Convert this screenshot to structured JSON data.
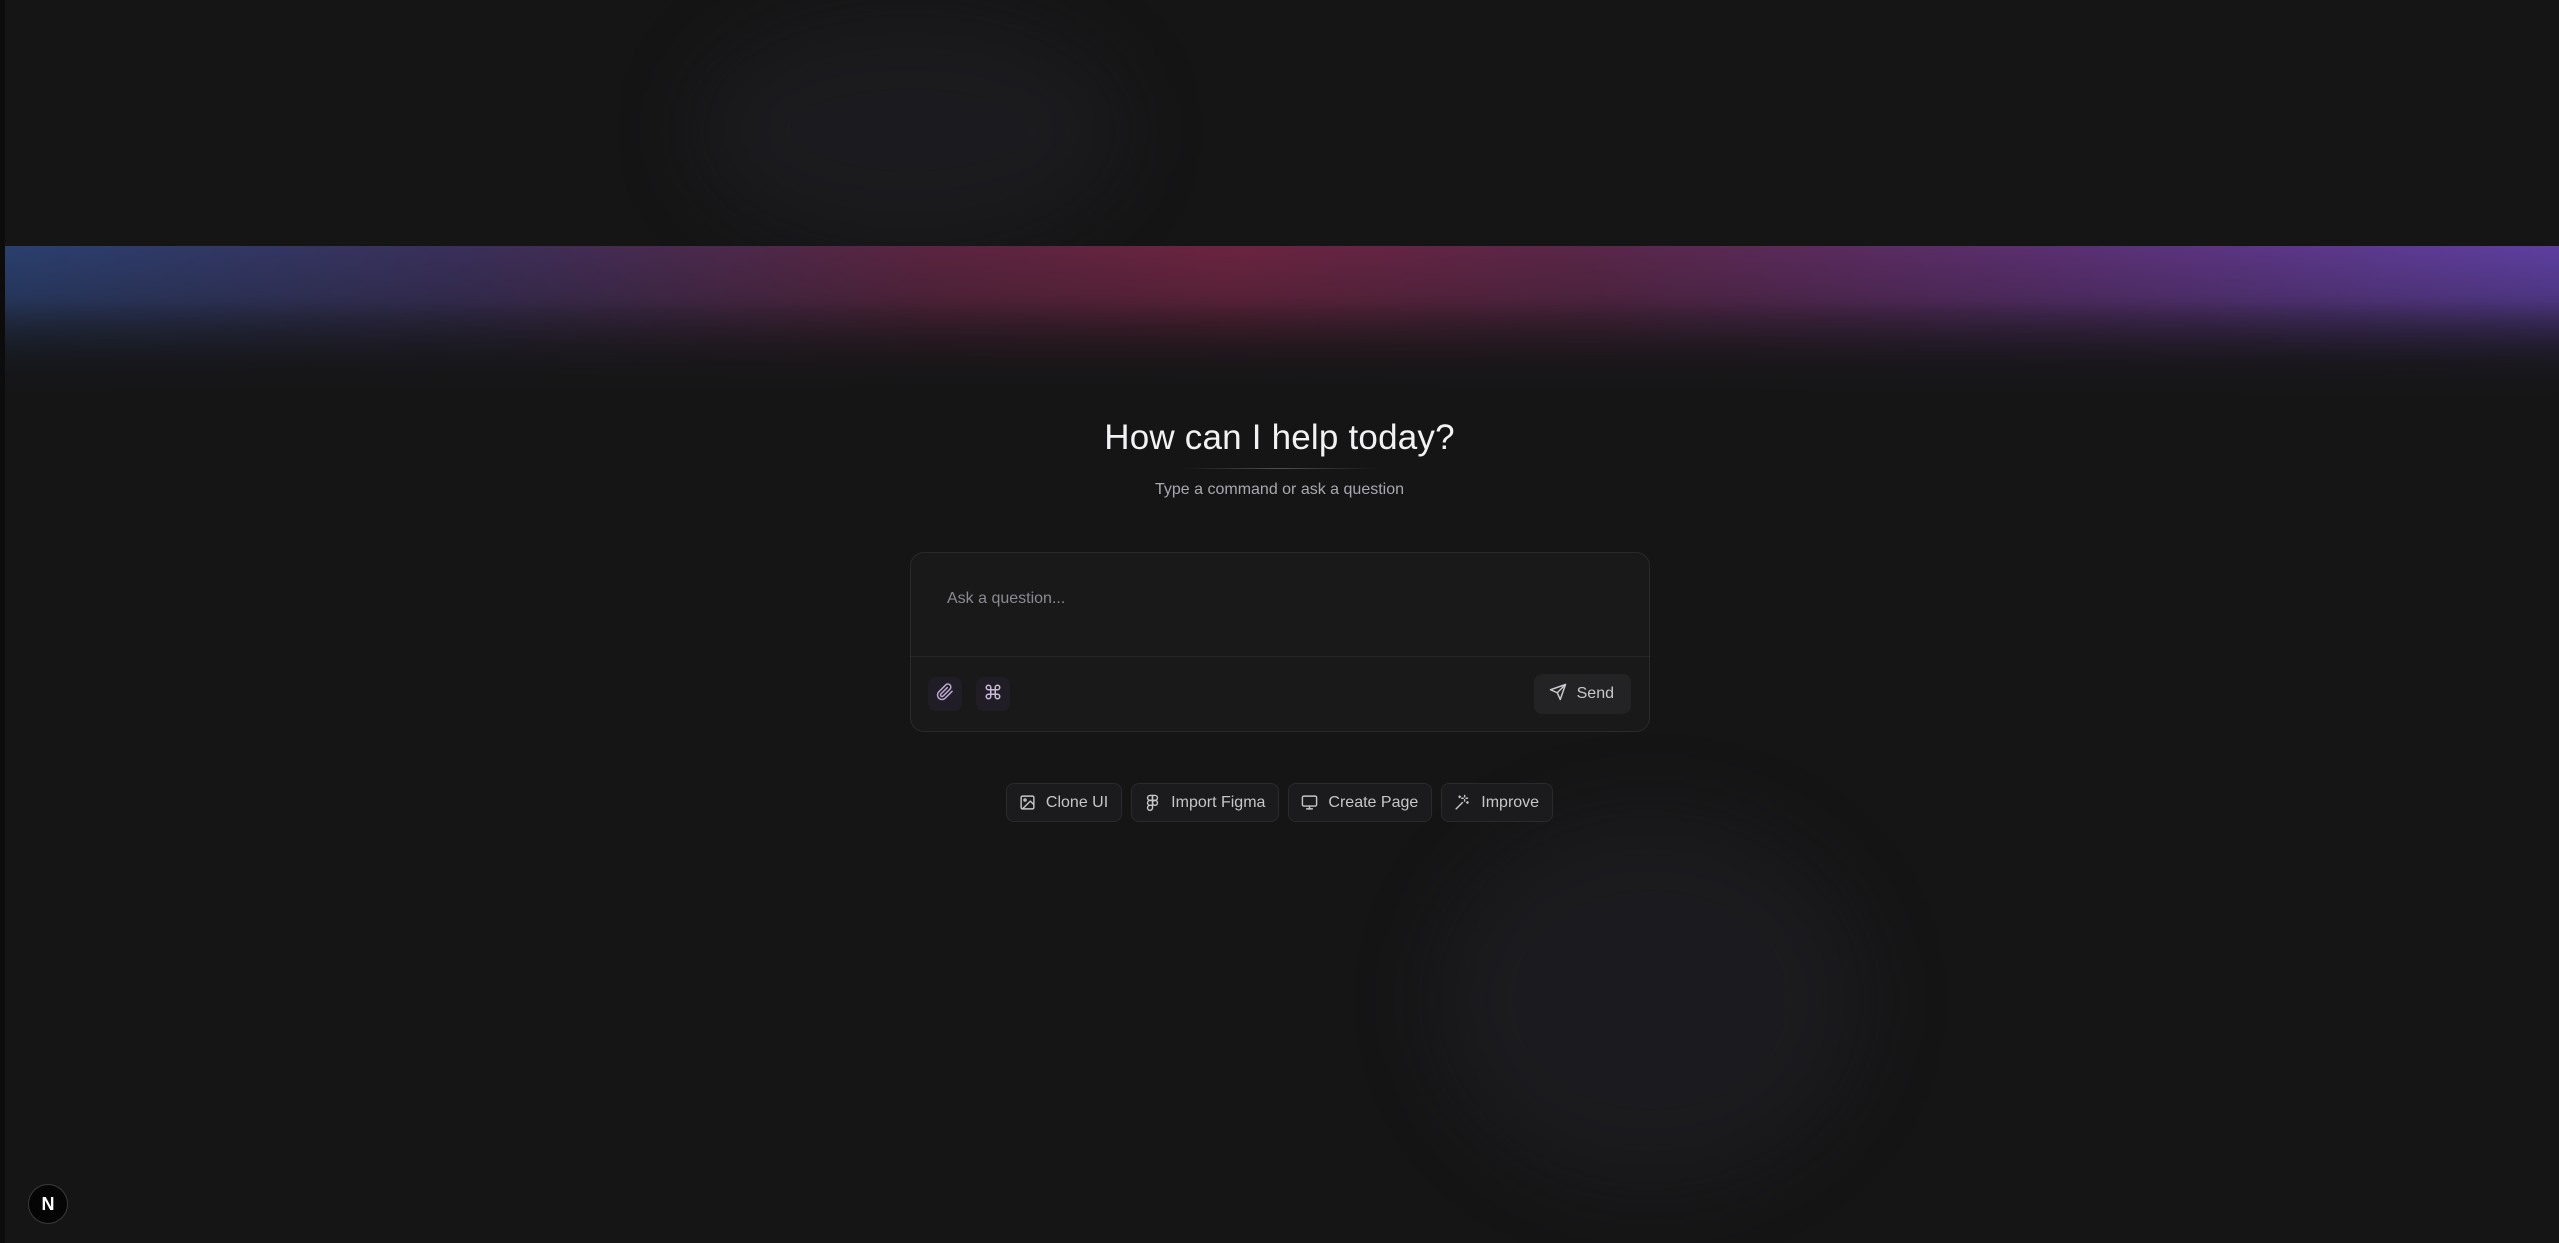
{
  "hero": {
    "title": "How can I help today?",
    "subtitle": "Type a command or ask a question"
  },
  "composer": {
    "placeholder": "Ask a question...",
    "value": "",
    "attach_icon": "paperclip-icon",
    "command_icon": "command-icon",
    "send_label": "Send",
    "send_icon": "send-icon"
  },
  "quick_actions": [
    {
      "label": "Clone UI",
      "icon": "image-icon"
    },
    {
      "label": "Import Figma",
      "icon": "figma-icon"
    },
    {
      "label": "Create Page",
      "icon": "monitor-icon"
    },
    {
      "label": "Improve",
      "icon": "sparkles-icon"
    }
  ],
  "footer": {
    "logo_letter": "N"
  },
  "colors": {
    "background": "#151516",
    "accent_gradient": [
      "#2a3f6e",
      "#6a2440",
      "#5d3fa0"
    ],
    "chip_bg": "#1b1b1d",
    "composer_bg": "#19191a"
  }
}
